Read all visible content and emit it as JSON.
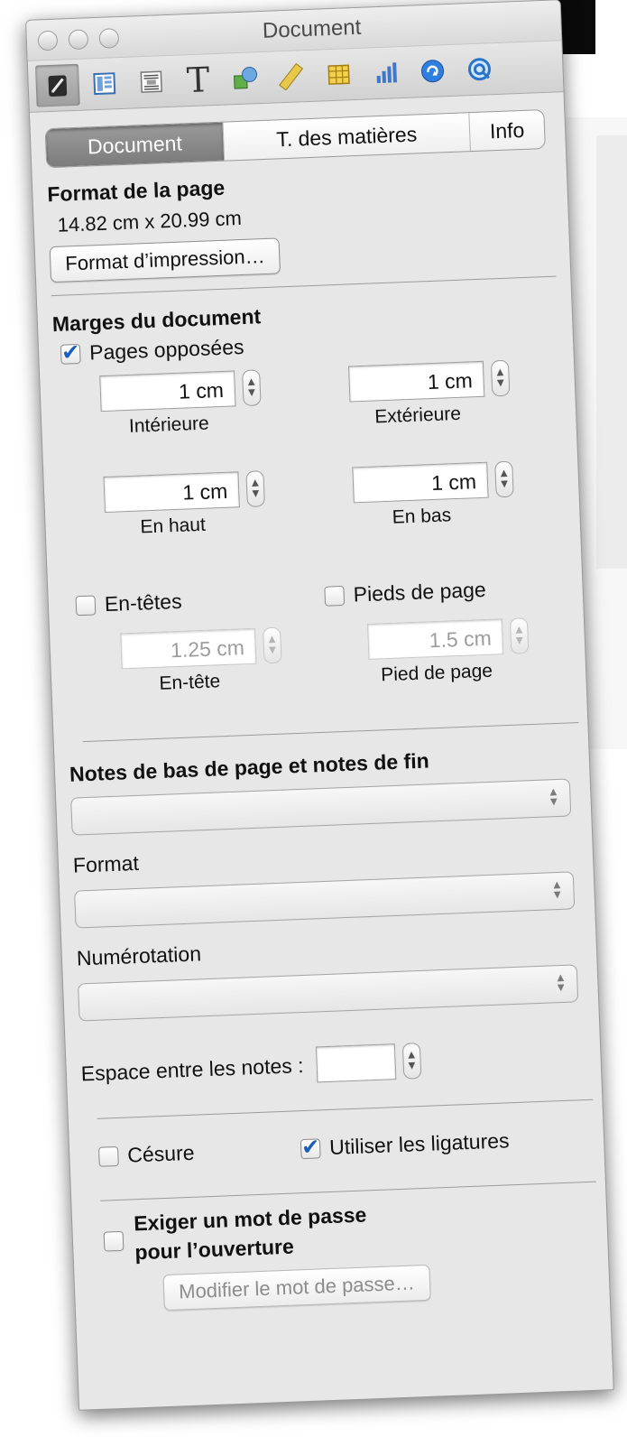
{
  "window": {
    "title": "Document"
  },
  "toolbar": {
    "tools": [
      {
        "name": "document-inspector-icon",
        "selected": true
      },
      {
        "name": "layout-inspector-icon",
        "selected": false
      },
      {
        "name": "wrap-inspector-icon",
        "selected": false
      },
      {
        "name": "text-inspector-icon",
        "selected": false,
        "glyph": "T"
      },
      {
        "name": "graphic-inspector-icon",
        "selected": false
      },
      {
        "name": "metrics-inspector-icon",
        "selected": false
      },
      {
        "name": "table-inspector-icon",
        "selected": false
      },
      {
        "name": "chart-inspector-icon",
        "selected": false
      },
      {
        "name": "link-inspector-icon",
        "selected": false
      },
      {
        "name": "quicktime-inspector-icon",
        "selected": false
      }
    ]
  },
  "tabs": [
    {
      "label": "Document",
      "active": true
    },
    {
      "label": "T. des matières",
      "active": false
    },
    {
      "label": "Info",
      "active": false
    }
  ],
  "page_format": {
    "heading": "Format de la page",
    "size": "14.82 cm x 20.99 cm",
    "button": "Format d’impression…"
  },
  "margins": {
    "heading": "Marges du document",
    "facing_pages": {
      "label": "Pages opposées",
      "checked": true
    },
    "inner": {
      "value": "1 cm",
      "label": "Intérieure"
    },
    "outer": {
      "value": "1 cm",
      "label": "Extérieure"
    },
    "top": {
      "value": "1 cm",
      "label": "En haut"
    },
    "bottom": {
      "value": "1 cm",
      "label": "En bas"
    }
  },
  "headers": {
    "label": "En-têtes",
    "checked": false,
    "value": "1.25 cm",
    "caption": "En-tête"
  },
  "footers": {
    "label": "Pieds de page",
    "checked": false,
    "value": "1.5 cm",
    "caption": "Pied de page"
  },
  "notes": {
    "heading": "Notes de bas de page et notes de fin",
    "format_label": "Format",
    "numbering_label": "Numérotation",
    "spacing_label": "Espace entre les notes :"
  },
  "hyphenation": {
    "label": "Césure",
    "checked": false
  },
  "ligatures": {
    "label": "Utiliser les ligatures",
    "checked": true
  },
  "password": {
    "label_line1": "Exiger un mot de passe",
    "label_line2": "pour l’ouverture",
    "checked": false,
    "button": "Modifier le mot de passe…"
  },
  "colors": {
    "accent": "#1a5fbf",
    "panel": "#e7e7e7",
    "selected_tab": "#8a8a8a"
  }
}
